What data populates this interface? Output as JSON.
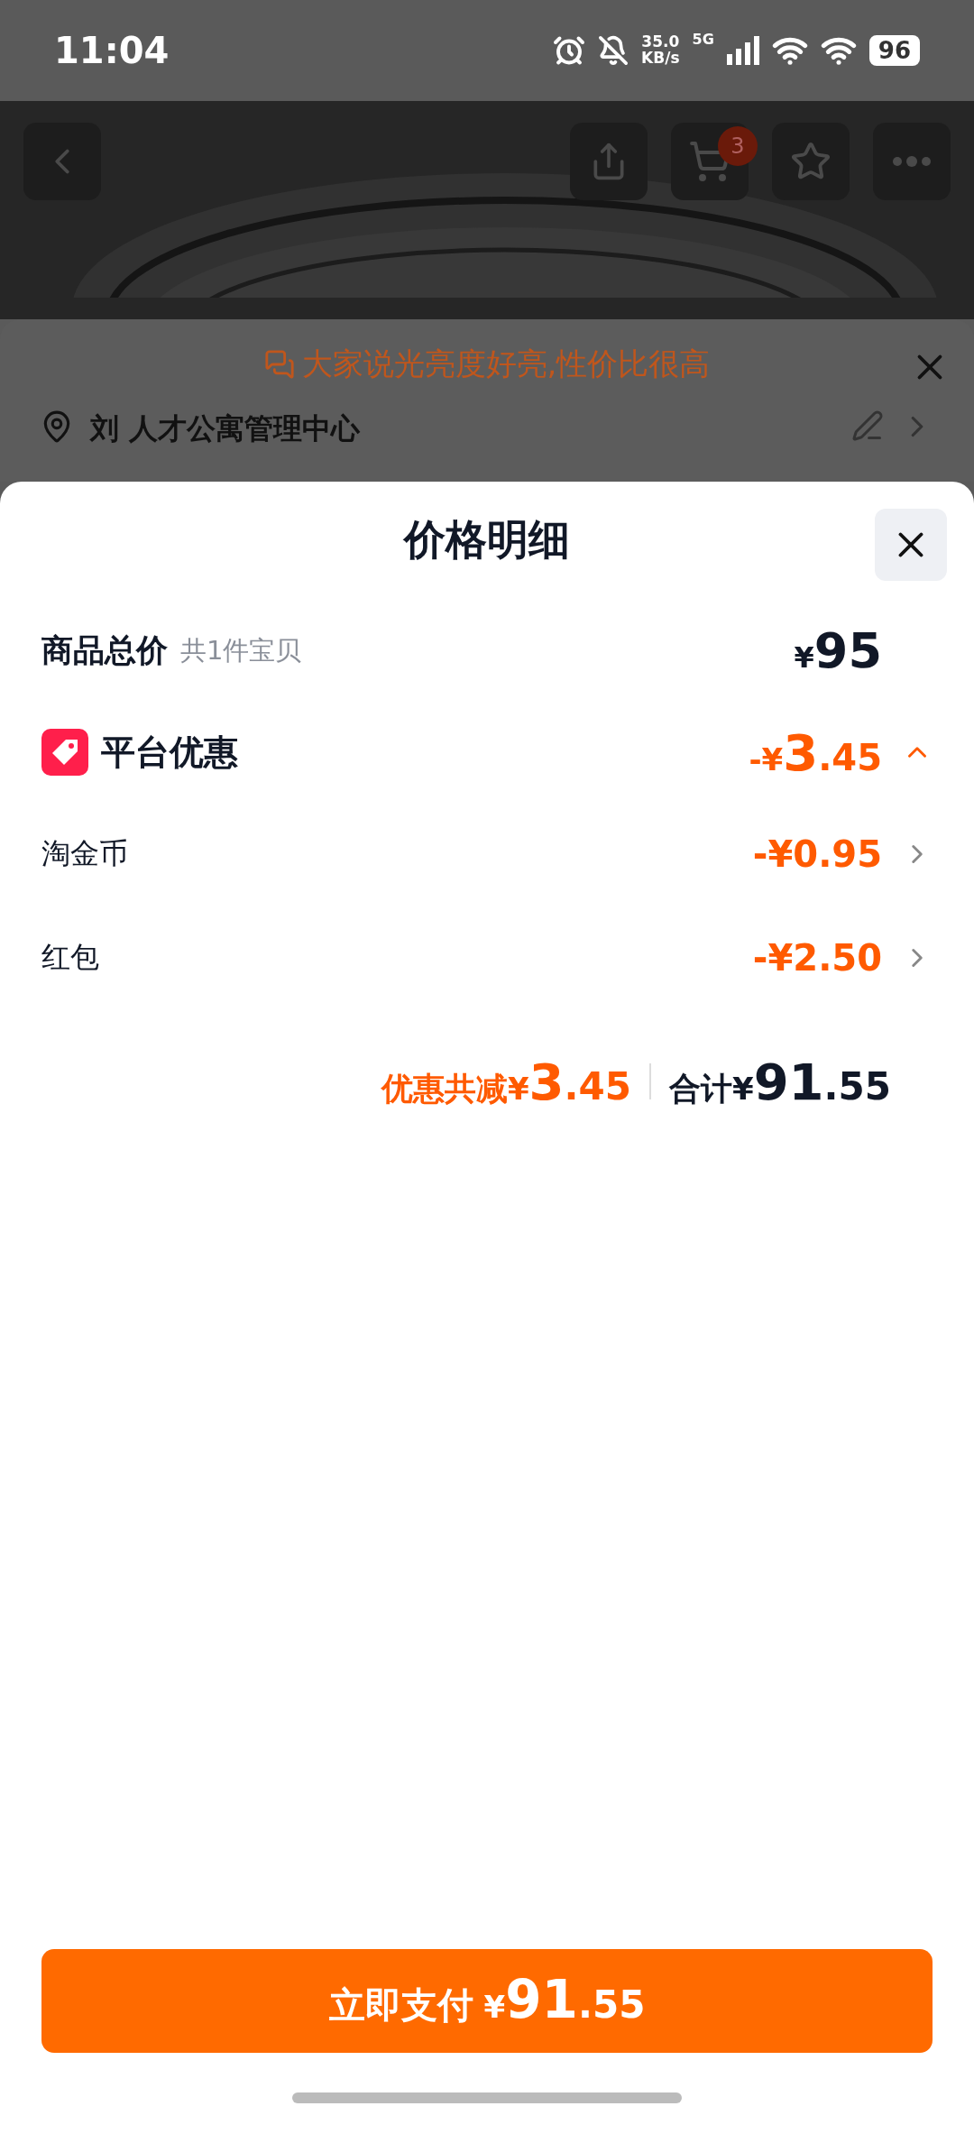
{
  "status_bar": {
    "time": "11:04",
    "net_speed": "35.0",
    "net_unit": "KB/s",
    "network": "5G",
    "battery": "96"
  },
  "header": {
    "cart_count": "3"
  },
  "tip": {
    "text": "大家说光亮度好亮,性价比很高"
  },
  "address": {
    "text": "刘 人才公寓管理中心"
  },
  "sheet": {
    "title": "价格明细",
    "items": [
      {
        "kind": "total",
        "label": "商品总价",
        "note": "共1件宝贝",
        "amount": "¥95"
      },
      {
        "kind": "group",
        "label": "平台优惠",
        "amount": "-¥3.45",
        "expanded": true
      },
      {
        "kind": "sub",
        "label": "淘金币",
        "amount": "-¥0.95"
      },
      {
        "kind": "sub",
        "label": "红包",
        "amount": "-¥2.50"
      }
    ],
    "summary": {
      "discount_label": "优惠共减",
      "discount": "¥3.45",
      "total_label": "合计",
      "total": "¥91.55"
    }
  },
  "pay_button": {
    "label": "立即支付",
    "amount": "¥91.55"
  }
}
